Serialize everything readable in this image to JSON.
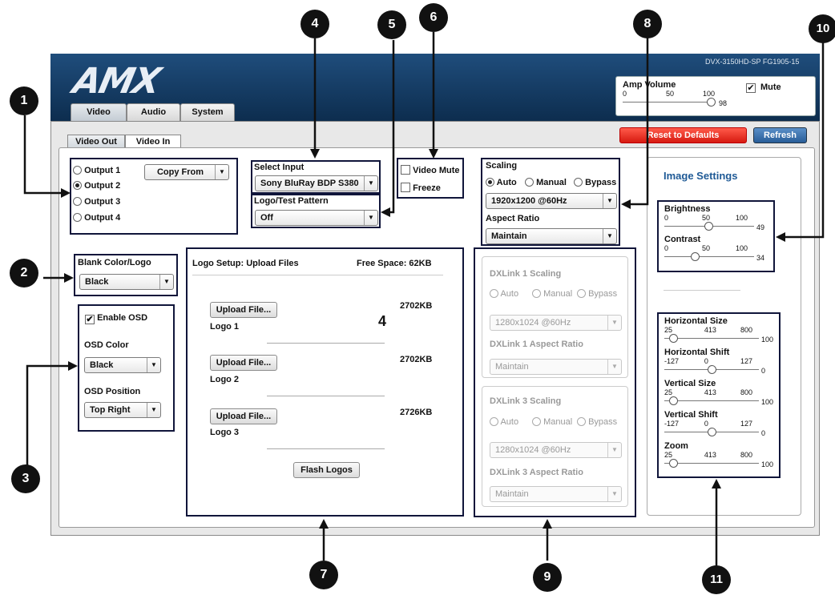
{
  "header": {
    "logo": "AMX",
    "model": "DVX-3150HD-SP   FG1905-15",
    "tabs": [
      "Video",
      "Audio",
      "System"
    ]
  },
  "amp": {
    "label": "Amp Volume",
    "ticks": [
      "0",
      "50",
      "100"
    ],
    "value": "98",
    "level": 98,
    "mute_label": "Mute",
    "mute_checked": true
  },
  "subtabs": [
    "Video Out",
    "Video In"
  ],
  "buttons": {
    "reset": "Reset to Defaults",
    "refresh": "Refresh"
  },
  "outputs": {
    "items": [
      "Output 1",
      "Output 2",
      "Output 3",
      "Output 4"
    ],
    "selected": "Output 2",
    "copy_from": "Copy From"
  },
  "select_input": {
    "label": "Select Input",
    "value": "Sony BluRay BDP S380"
  },
  "logo_test": {
    "label": "Logo/Test Pattern",
    "value": "Off"
  },
  "video_mute": {
    "label": "Video Mute",
    "checked": false
  },
  "freeze": {
    "label": "Freeze",
    "checked": false
  },
  "scaling": {
    "label": "Scaling",
    "modes": [
      "Auto",
      "Manual",
      "Bypass"
    ],
    "selected": "Auto",
    "resolution": "1920x1200 @60Hz",
    "aspect_label": "Aspect Ratio",
    "aspect_value": "Maintain"
  },
  "blank": {
    "label": "Blank Color/Logo",
    "value": "Black"
  },
  "osd": {
    "enable_label": "Enable OSD",
    "enabled": true,
    "color_label": "OSD Color",
    "color_value": "Black",
    "position_label": "OSD Position",
    "position_value": "Top Right"
  },
  "logo_setup": {
    "title": "Logo Setup: Upload Files",
    "free_space": "Free Space:  62KB",
    "count": "4",
    "upload_label": "Upload File...",
    "logos": [
      {
        "name": "Logo 1",
        "size": "2702KB"
      },
      {
        "name": "Logo 2",
        "size": "2702KB"
      },
      {
        "name": "Logo 3",
        "size": "2726KB"
      }
    ],
    "flash": "Flash Logos"
  },
  "dxlink1": {
    "scaling_label": "DXLink 1 Scaling",
    "modes": [
      "Auto",
      "Manual",
      "Bypass"
    ],
    "resolution": "1280x1024 @60Hz",
    "aspect_label": "DXLink 1 Aspect Ratio",
    "aspect_value": "Maintain"
  },
  "dxlink3": {
    "scaling_label": "DXLink 3 Scaling",
    "modes": [
      "Auto",
      "Manual",
      "Bypass"
    ],
    "resolution": "1280x1024 @60Hz",
    "aspect_label": "DXLink 3 Aspect Ratio",
    "aspect_value": "Maintain"
  },
  "image_settings": {
    "title": "Image Settings",
    "top": [
      {
        "label": "Brightness",
        "min": "0",
        "mid": "50",
        "max": "100",
        "value": "49",
        "level": 0.49
      },
      {
        "label": "Contrast",
        "min": "0",
        "mid": "50",
        "max": "100",
        "value": "34",
        "level": 0.34
      }
    ],
    "bottom": [
      {
        "label": "Horizontal Size",
        "min": "25",
        "mid": "413",
        "max": "800",
        "value": "100",
        "level": 0.097
      },
      {
        "label": "Horizontal Shift",
        "min": "-127",
        "mid": "0",
        "max": "127",
        "value": "0",
        "level": 0.5
      },
      {
        "label": "Vertical Size",
        "min": "25",
        "mid": "413",
        "max": "800",
        "value": "100",
        "level": 0.097
      },
      {
        "label": "Vertical Shift",
        "min": "-127",
        "mid": "0",
        "max": "127",
        "value": "0",
        "level": 0.5
      },
      {
        "label": "Zoom",
        "min": "25",
        "mid": "413",
        "max": "800",
        "value": "100",
        "level": 0.097
      }
    ]
  },
  "callouts": [
    "1",
    "2",
    "3",
    "4",
    "5",
    "6",
    "7",
    "8",
    "9",
    "10",
    "11"
  ],
  "colors": {
    "header": "#1f4d7c",
    "reset": "#e8291c",
    "refresh": "#3b73b0",
    "accent": "#1f5a96",
    "callout": "#10153a"
  }
}
